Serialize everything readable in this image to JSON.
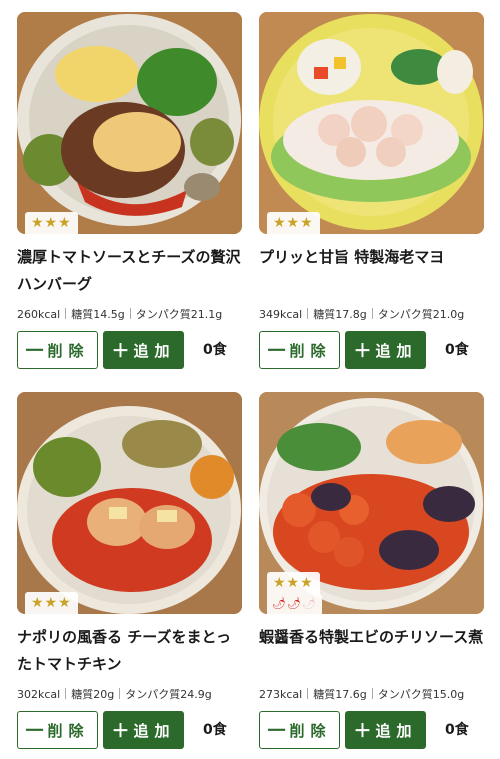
{
  "menu_items": [
    {
      "rating": "★★★",
      "title": "濃厚トマトソースとチーズの贅沢ハンバーグ",
      "kcal": "260kcal",
      "carbs": "糖質14.5g",
      "protein": "タンパク質21.1g",
      "remove_label": "削除",
      "add_label": "追加",
      "count": "0食"
    },
    {
      "rating": "★★★",
      "title": "プリッと甘旨 特製海老マヨ",
      "kcal": "349kcal",
      "carbs": "糖質17.8g",
      "protein": "タンパク質21.0g",
      "remove_label": "削除",
      "add_label": "追加",
      "count": "0食"
    },
    {
      "rating": "★★★",
      "title": "ナポリの風香る チーズをまとったトマトチキン",
      "kcal": "302kcal",
      "carbs": "糖質20g",
      "protein": "タンパク質24.9g",
      "remove_label": "削除",
      "add_label": "追加",
      "count": "0食"
    },
    {
      "rating": "★★★",
      "spice_level": 2,
      "spice_max": 3,
      "title": "蝦醤香る特製エビのチリソース煮",
      "kcal": "273kcal",
      "carbs": "糖質17.6g",
      "protein": "タンパク質15.0g",
      "remove_label": "削除",
      "add_label": "追加",
      "count": "0食"
    }
  ],
  "icons": {
    "remove": "minus-icon",
    "add": "plus-icon",
    "rating": "star-icon",
    "spice": "chili-pepper-icon"
  },
  "colors": {
    "accent": "#2b6a2b",
    "star": "#c9a227",
    "chili": "#d52b1e"
  }
}
